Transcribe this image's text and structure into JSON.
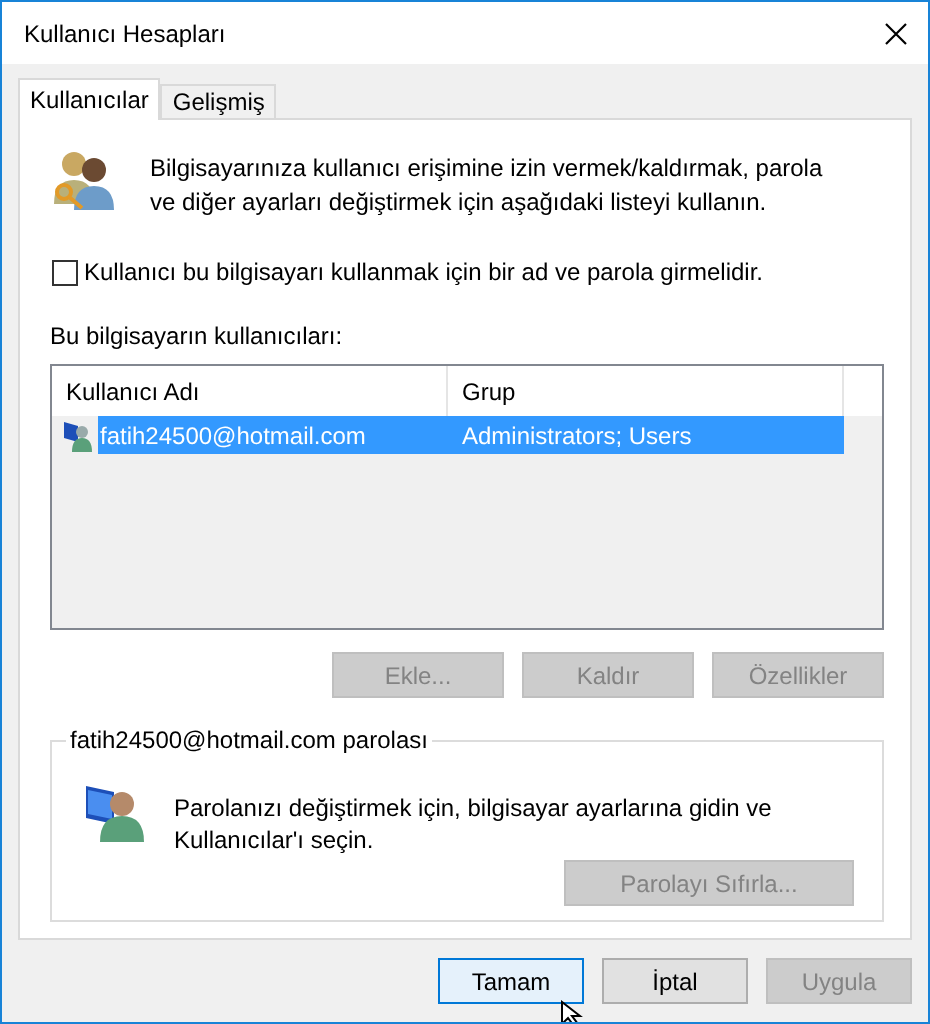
{
  "window": {
    "title": "Kullanıcı Hesapları"
  },
  "tabs": [
    {
      "label": "Kullanıcılar",
      "selected": true
    },
    {
      "label": "Gelişmiş",
      "selected": false
    }
  ],
  "intro": "Bilgisayarınıza kullanıcı erişimine izin vermek/kaldırmak, parola ve diğer ayarları değiştirmek için aşağıdaki listeyi kullanın.",
  "require_password": {
    "label": "Kullanıcı bu bilgisayarı kullanmak için bir ad ve parola girmelidir.",
    "checked": false
  },
  "users_label": "Bu bilgisayarın kullanıcıları:",
  "users_table": {
    "columns": [
      "Kullanıcı Adı",
      "Grup"
    ],
    "rows": [
      {
        "name": "fatih24500@hotmail.com",
        "group": "Administrators; Users",
        "selected": true
      }
    ]
  },
  "list_buttons": [
    {
      "label": "Ekle...",
      "disabled": true
    },
    {
      "label": "Kaldır",
      "disabled": true
    },
    {
      "label": "Özellikler",
      "disabled": true
    }
  ],
  "password_group": {
    "title": "fatih24500@hotmail.com parolası",
    "text": "Parolanızı değiştirmek için, bilgisayar ayarlarına gidin ve Kullanıcılar'ı seçin.",
    "button": {
      "label": "Parolayı Sıfırla...",
      "disabled": true
    }
  },
  "dialog_buttons": [
    {
      "label": "Tamam",
      "disabled": false,
      "focused": true
    },
    {
      "label": "İptal",
      "disabled": false,
      "focused": false
    },
    {
      "label": "Uygula",
      "disabled": true,
      "focused": false
    }
  ]
}
